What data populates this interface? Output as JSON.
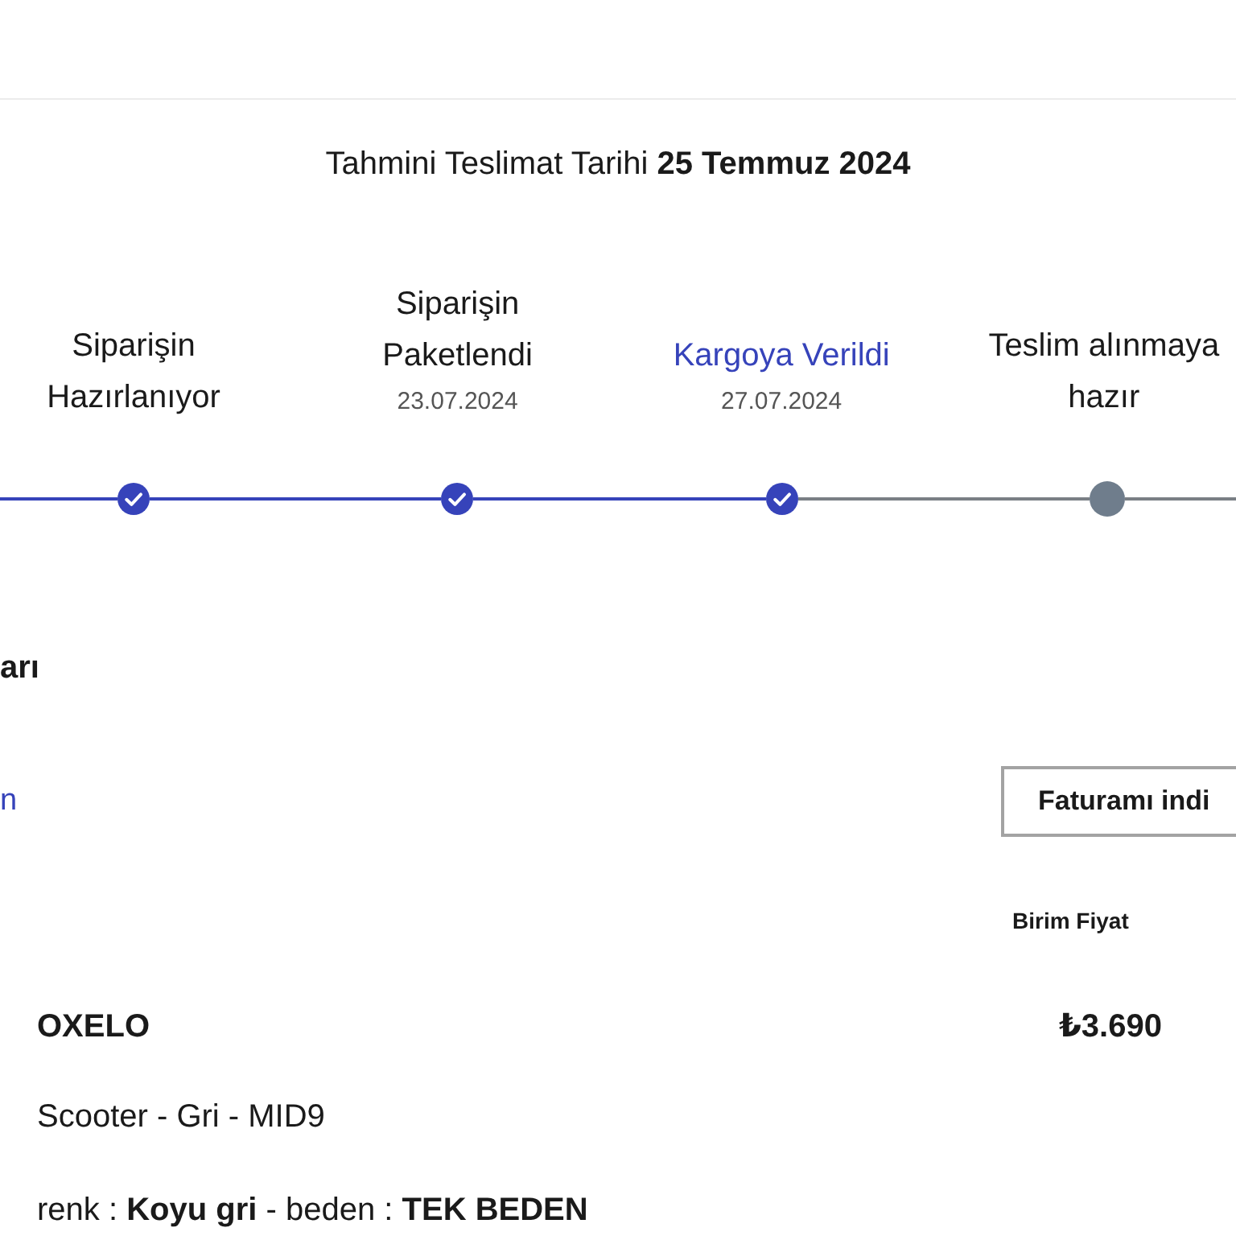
{
  "delivery_estimate": "Tahmini Teslimat Tarihi **25 Temmuz 2024**",
  "steps": [
    {
      "label": "Siparişin Hazırlanıyor",
      "done": true,
      "current": false
    },
    {
      "label": "Siparişin Paketlendi",
      "date": "23.07.2024",
      "done": true,
      "current": false
    },
    {
      "label": "Kargoya Verildi",
      "date": "27.07.2024",
      "done": true,
      "current": true
    },
    {
      "label": "Teslim alınmaya hazır",
      "done": false,
      "current": false
    }
  ],
  "section": {
    "title": "arı",
    "link": "n",
    "invoice_button": "Faturamı indi"
  },
  "items_table": {
    "columns": [
      "Birim Fiyat"
    ],
    "rows": [
      {
        "brand": "OXELO",
        "description": "Scooter - Gri - MID9",
        "attributes": "renk : **Koyu gri** - beden : **TEK BEDEN**",
        "unit_price": "₺3.690"
      }
    ]
  }
}
